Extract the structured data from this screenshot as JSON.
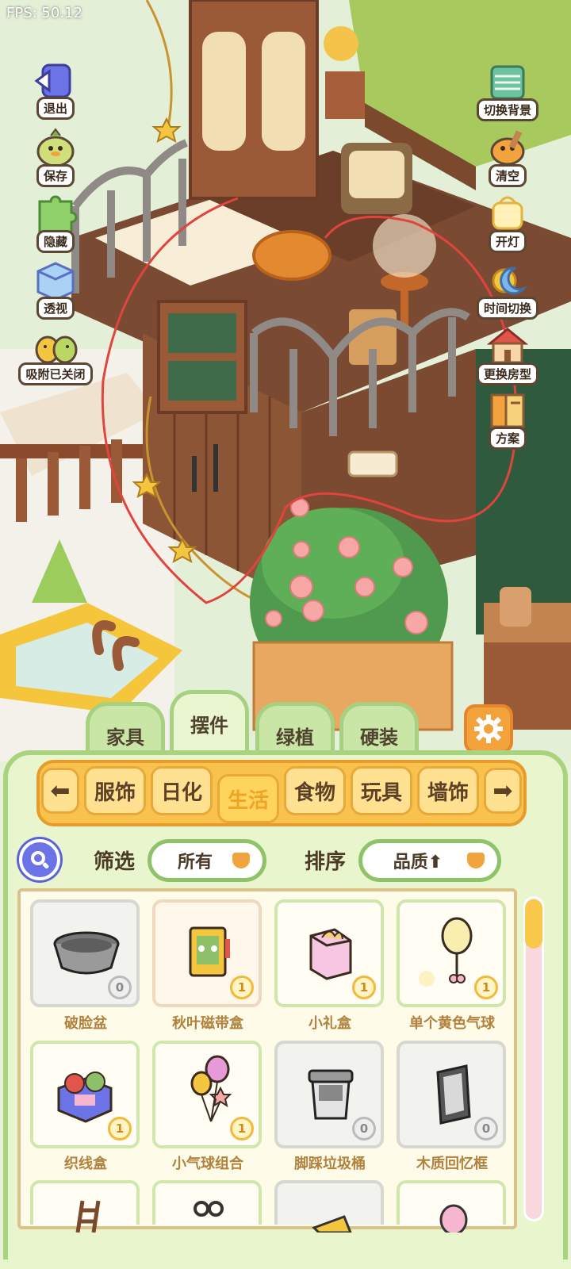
{
  "fps": "FPS: 50.12",
  "left_buttons": [
    {
      "label": "退出",
      "icon": "exit-door-icon"
    },
    {
      "label": "保存",
      "icon": "save-duck-icon"
    },
    {
      "label": "隐藏",
      "icon": "hide-puzzle-icon"
    },
    {
      "label": "透视",
      "icon": "perspective-cube-icon"
    },
    {
      "label": "吸附已关闭",
      "icon": "snap-ducks-icon"
    }
  ],
  "right_buttons": [
    {
      "label": "切换背景",
      "icon": "switch-background-icon"
    },
    {
      "label": "清空",
      "icon": "clear-icon"
    },
    {
      "label": "开灯",
      "icon": "light-icon"
    },
    {
      "label": "时间切换",
      "icon": "time-switch-icon"
    },
    {
      "label": "更换房型",
      "icon": "change-room-icon"
    },
    {
      "label": "方案",
      "icon": "plan-book-icon"
    }
  ],
  "category_tabs": [
    "家具",
    "摆件",
    "绿植",
    "硬装"
  ],
  "active_category": "摆件",
  "sub_tabs": [
    "服饰",
    "日化",
    "生活",
    "食物",
    "玩具",
    "墙饰"
  ],
  "active_sub_tab": "生活",
  "filter": {
    "label": "筛选",
    "value": "所有"
  },
  "sort": {
    "label": "排序",
    "value": "品质⬆"
  },
  "items": [
    {
      "name": "破脸盆",
      "count": "0",
      "icon": "basin-icon"
    },
    {
      "name": "秋叶磁带盒",
      "count": "1",
      "icon": "cassette-box-icon"
    },
    {
      "name": "小礼盒",
      "count": "1",
      "icon": "gift-box-icon"
    },
    {
      "name": "单个黄色气球",
      "count": "1",
      "icon": "yellow-balloon-icon"
    },
    {
      "name": "织线盒",
      "count": "1",
      "icon": "yarn-box-icon"
    },
    {
      "name": "小气球组合",
      "count": "1",
      "icon": "balloon-bunch-icon"
    },
    {
      "name": "脚踩垃圾桶",
      "count": "0",
      "icon": "trash-can-icon"
    },
    {
      "name": "木质回忆框",
      "count": "0",
      "icon": "memory-frame-icon"
    }
  ],
  "colors": {
    "panel_green": "#e8f5cd",
    "tab_orange": "#f8c24d",
    "text_brown": "#4a3a26",
    "item_text": "#b0823d"
  }
}
